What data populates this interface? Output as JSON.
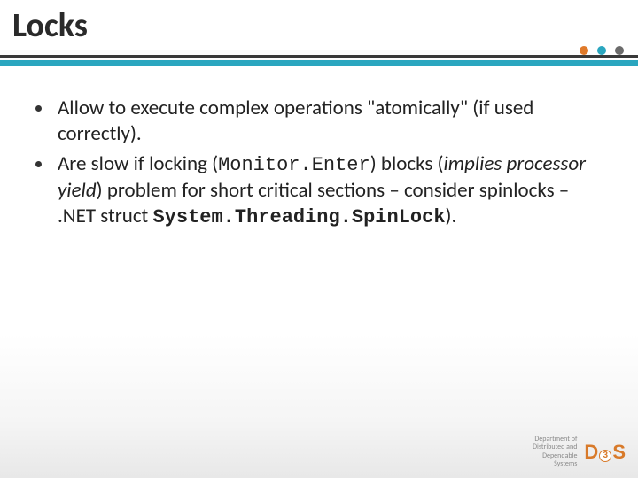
{
  "title": "Locks",
  "bullets": [
    {
      "segments": [
        {
          "t": "Allow to execute complex operations \"atomically\" (if used correctly)."
        }
      ]
    },
    {
      "segments": [
        {
          "t": "Are slow if locking ("
        },
        {
          "t": "Monitor.Enter",
          "cls": "mono"
        },
        {
          "t": ") blocks ("
        },
        {
          "t": "implies processor yield",
          "cls": "ital"
        },
        {
          "t": ") problem for short critical sections – consider spinlocks – .NET struct "
        },
        {
          "t": "System.Threading.SpinLock",
          "cls": "mono-bold"
        },
        {
          "t": ")."
        }
      ]
    }
  ],
  "footer": {
    "dept_line1": "Department of",
    "dept_line2": "Distributed and",
    "dept_line3": "Dependable",
    "dept_line4": "Systems",
    "logo_d": "D",
    "logo_3": "3",
    "logo_s": "S"
  }
}
